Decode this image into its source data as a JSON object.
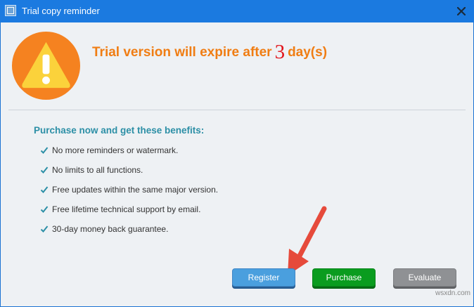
{
  "window": {
    "title": "Trial copy reminder",
    "close_glyph": "X"
  },
  "header": {
    "text_before": "Trial version will expire after",
    "days": "3",
    "text_after": "day(s)"
  },
  "benefits": {
    "title": "Purchase now and get these benefits:",
    "items": [
      "No more reminders or watermark.",
      "No limits to all functions.",
      "Free updates within the same major version.",
      "Free lifetime technical support by email.",
      "30-day money back guarantee."
    ]
  },
  "buttons": {
    "register": "Register",
    "purchase": "Purchase",
    "evaluate": "Evaluate"
  },
  "watermark": "wsxdn.com",
  "colors": {
    "accent_orange": "#f07d13",
    "days_red": "#e1141b",
    "benefits_teal": "#2c8fa6",
    "register_blue": "#4a9fde",
    "purchase_green": "#0a9c1f",
    "evaluate_gray": "#8f9194",
    "arrow_red": "#e64a3b"
  },
  "icons": {
    "warning": "warning-icon",
    "check": "check-icon",
    "close": "close-icon",
    "app": "app-icon"
  }
}
